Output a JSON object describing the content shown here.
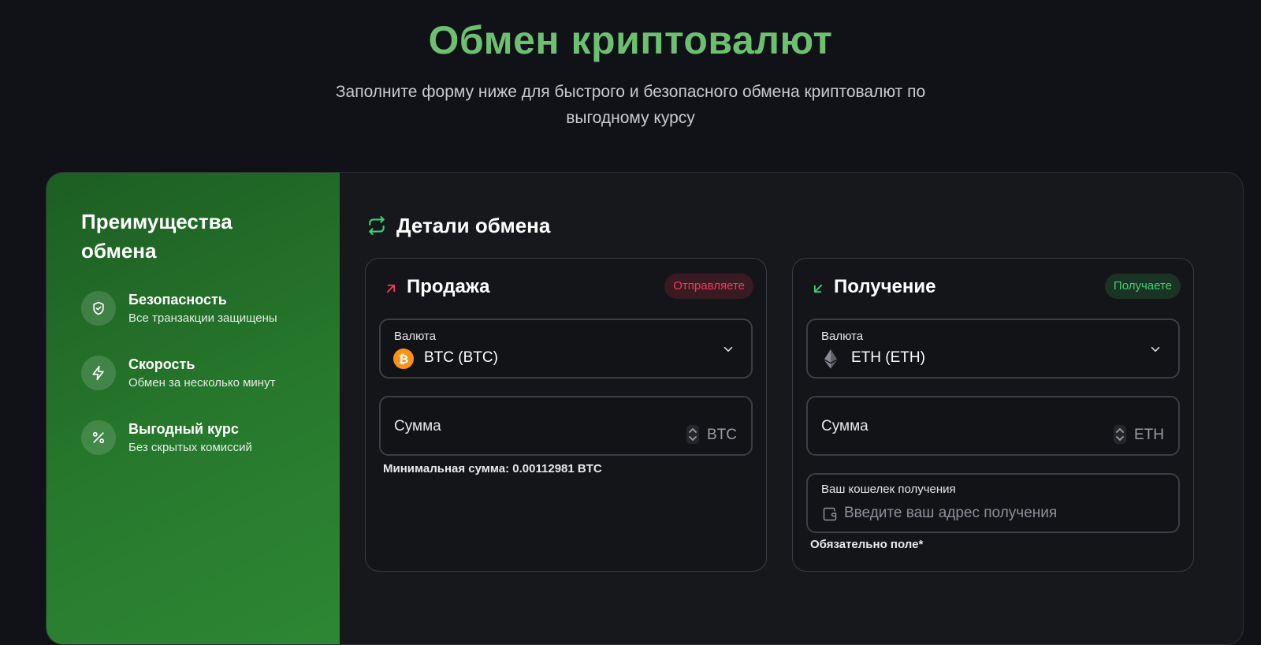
{
  "hero": {
    "title": "Обмен криптовалют",
    "subtitle": "Заполните форму ниже для быстрого и безопасного обмена криптовалют по выгодному курсу"
  },
  "benefits": {
    "title": "Преимущества обмена",
    "items": [
      {
        "icon": "shield-icon",
        "title": "Безопасность",
        "desc": "Все транзакции защищены"
      },
      {
        "icon": "lightning-icon",
        "title": "Скорость",
        "desc": "Обмен за несколько минут"
      },
      {
        "icon": "percent-icon",
        "title": "Выгодный курс",
        "desc": "Без скрытых комиссий"
      }
    ]
  },
  "exchange": {
    "title": "Детали обмена",
    "sell": {
      "title": "Продажа",
      "badge": "Отправляете",
      "currency_label": "Валюта",
      "currency_value": "BTC (BTC)",
      "coin_icon": "bitcoin-icon",
      "amount_label": "Сумма",
      "unit": "BTC",
      "hint": "Минимальная сумма: 0.00112981 BTC"
    },
    "receive": {
      "title": "Получение",
      "badge": "Получаете",
      "currency_label": "Валюта",
      "currency_value": "ETH (ETH)",
      "coin_icon": "ethereum-icon",
      "amount_label": "Сумма",
      "unit": "ETH",
      "wallet_label": "Ваш кошелек получения",
      "wallet_placeholder": "Введите ваш адрес получения",
      "required_note": "Обязательно поле*"
    }
  },
  "colors": {
    "accent_green": "#6cc070",
    "send_red": "#ee3a5e",
    "receive_green": "#3fcf72",
    "background": "#111217"
  }
}
